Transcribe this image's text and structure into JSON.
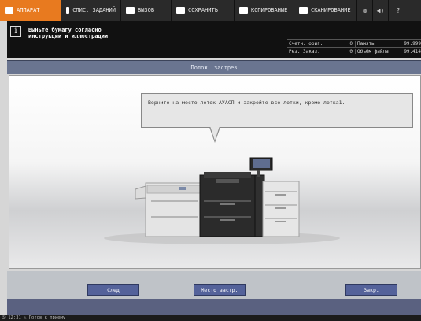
{
  "tabs": [
    {
      "label": "АППАРАТ",
      "icon": "machine-icon",
      "active": true
    },
    {
      "label": "СПИС. ЗАДАНИЙ",
      "icon": "job-list-icon",
      "active": false
    },
    {
      "label": "ВЫЗОВ",
      "icon": "recall-icon",
      "active": false
    },
    {
      "label": "СОХРАНИТЬ",
      "icon": "save-icon",
      "active": false
    },
    {
      "label": "КОПИРОВАНИЕ",
      "icon": "copy-icon",
      "active": false
    },
    {
      "label": "СКАНИРОВАНИЕ",
      "icon": "scan-icon",
      "active": false
    }
  ],
  "tab_icons": {
    "globe": "◍",
    "sound": "◀)",
    "help": "?"
  },
  "message": {
    "line1": "Выньте бумагу согласно",
    "line2": "инструкции и иллюстрации",
    "icon": "info-icon"
  },
  "counters": {
    "row1": {
      "label": "Счетч. ориг.",
      "value": "0",
      "label2": "Память",
      "value2": "99.999"
    },
    "row2": {
      "label": "Рез. Заказ.",
      "value": "0",
      "label2": "Объём файла",
      "value2": "99.414"
    }
  },
  "section_title": "Полож. застрев",
  "instruction": "Верните на место лоток АУАСП и закройте все лотки, кроме лотка1.",
  "buttons": {
    "next": "След",
    "jam_location": "Место застр.",
    "close": "Закр."
  },
  "status": "⑤ 12:31  ⚠ Готов к приему",
  "colors": {
    "accent": "#e87a1f",
    "header": "#6a7590",
    "button": "#54629a"
  }
}
